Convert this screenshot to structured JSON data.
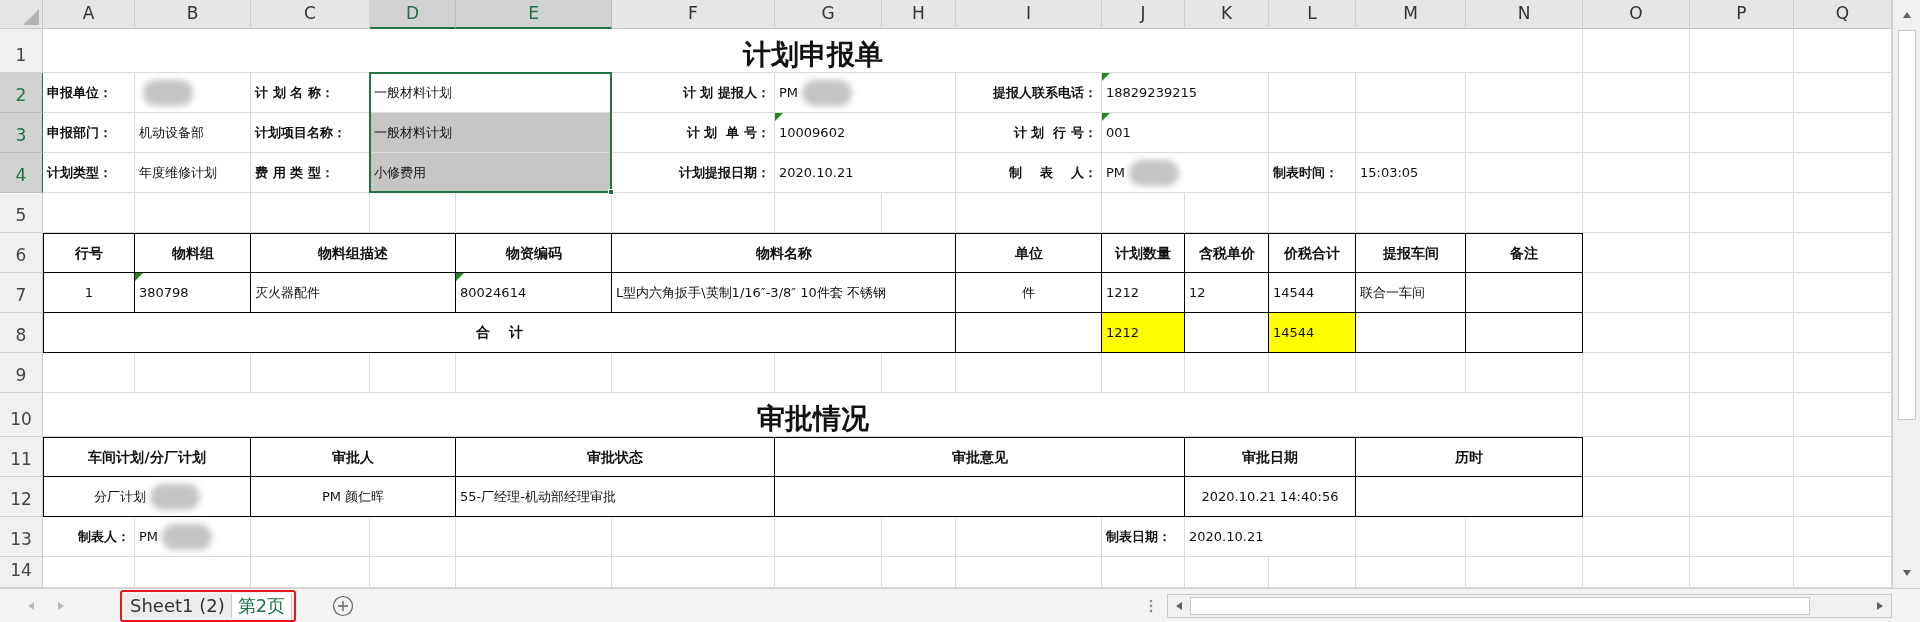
{
  "column_headers": [
    {
      "label": "A",
      "selected": false
    },
    {
      "label": "B",
      "selected": false
    },
    {
      "label": "C",
      "selected": false
    },
    {
      "label": "D",
      "selected": true
    },
    {
      "label": "E",
      "selected": true
    },
    {
      "label": "F",
      "selected": false
    },
    {
      "label": "G",
      "selected": false
    },
    {
      "label": "H",
      "selected": false
    },
    {
      "label": "I",
      "selected": false
    },
    {
      "label": "J",
      "selected": false
    },
    {
      "label": "K",
      "selected": false
    },
    {
      "label": "L",
      "selected": false
    },
    {
      "label": "M",
      "selected": false
    },
    {
      "label": "N",
      "selected": false
    },
    {
      "label": "O",
      "selected": false
    },
    {
      "label": "P",
      "selected": false
    },
    {
      "label": "Q",
      "selected": false
    }
  ],
  "row_headers": [
    {
      "label": "1",
      "selected": false
    },
    {
      "label": "2",
      "selected": true
    },
    {
      "label": "3",
      "selected": true
    },
    {
      "label": "4",
      "selected": true
    },
    {
      "label": "5",
      "selected": false
    },
    {
      "label": "6",
      "selected": false
    },
    {
      "label": "7",
      "selected": false
    },
    {
      "label": "8",
      "selected": false
    },
    {
      "label": "9",
      "selected": false
    },
    {
      "label": "10",
      "selected": false
    },
    {
      "label": "11",
      "selected": false
    },
    {
      "label": "12",
      "selected": false
    },
    {
      "label": "13",
      "selected": false
    },
    {
      "label": "14",
      "selected": false
    }
  ],
  "title": "计划申报单",
  "form": [
    [
      {
        "kind": "label",
        "text": "申报单位："
      },
      {
        "kind": "value",
        "flagged": false,
        "redacted": true
      },
      {
        "kind": "label",
        "text": "计 划 名 称："
      },
      {
        "kind": "value",
        "text": "一般材料计划",
        "flagged": false,
        "redacted": false,
        "selected": false
      },
      {
        "kind": "label",
        "text": "计 划 提报人："
      },
      {
        "kind": "value",
        "text": "PM",
        "flagged": false,
        "redacted": true
      },
      {
        "kind": "label",
        "text": "提报人联系电话："
      },
      {
        "kind": "value",
        "text": "18829239215",
        "flagged": true,
        "redacted": false
      }
    ],
    [
      {
        "kind": "label",
        "text": "申报部门："
      },
      {
        "kind": "value",
        "text": "机动设备部",
        "flagged": false,
        "redacted": false
      },
      {
        "kind": "label",
        "text": "计划项目名称："
      },
      {
        "kind": "value",
        "text": "一般材料计划",
        "flagged": false,
        "redacted": false,
        "selected": true
      },
      {
        "kind": "label",
        "text": "计 划  单 号："
      },
      {
        "kind": "value",
        "text": "10009602",
        "flagged": true,
        "redacted": false
      },
      {
        "kind": "label",
        "text": "计 划  行 号："
      },
      {
        "kind": "value",
        "text": "001",
        "flagged": true,
        "redacted": false
      }
    ],
    [
      {
        "kind": "label",
        "text": "计划类型："
      },
      {
        "kind": "value",
        "text": "年度维修计划",
        "flagged": false,
        "redacted": false
      },
      {
        "kind": "label",
        "text": "费 用 类 型："
      },
      {
        "kind": "value",
        "text": "小修费用",
        "flagged": false,
        "redacted": false,
        "selected": true
      },
      {
        "kind": "label",
        "text": "计划提报日期："
      },
      {
        "kind": "value",
        "text": "2020.10.21",
        "flagged": false,
        "redacted": false
      },
      {
        "kind": "label",
        "text": "制    表    人："
      },
      {
        "kind": "value",
        "text": "PM",
        "flagged": false,
        "redacted": true
      },
      {
        "kind": "label",
        "text": "制表时间："
      },
      {
        "kind": "value",
        "text": "15:03:05",
        "flagged": false,
        "redacted": false
      }
    ]
  ],
  "material_table": {
    "columns": [
      "行号",
      "物料组",
      "物料组描述",
      "物资编码",
      "物料名称",
      "单位",
      "计划数量",
      "含税单价",
      "价税合计",
      "提报车间",
      "备注"
    ],
    "rows": [
      [
        {
          "text": "1",
          "flagged": false
        },
        {
          "text": "380798",
          "flagged": true
        },
        {
          "text": "灭火器配件",
          "flagged": false
        },
        {
          "text": "80024614",
          "flagged": true
        },
        {
          "text": "L型内六角扳手\\英制1/16″-3/8″ 10件套 不锈钢",
          "flagged": false
        },
        {
          "text": "件",
          "flagged": false
        },
        {
          "text": "1212",
          "flagged": false
        },
        {
          "text": "12",
          "flagged": false
        },
        {
          "text": "14544",
          "flagged": false
        },
        {
          "text": "联合一车间",
          "flagged": false
        }
      ]
    ],
    "total": {
      "label": "合    计",
      "quantity": {
        "text": "1212",
        "highlighted": true
      },
      "amount": {
        "text": "14544",
        "highlighted": true
      }
    }
  },
  "approval_title": "审批情况",
  "approval_table": {
    "columns": [
      "车间计划/分厂计划",
      "审批人",
      "审批状态",
      "审批意见",
      "审批日期",
      "历时"
    ],
    "rows": [
      {
        "plan": {
          "text": "分厂计划",
          "redacted": true
        },
        "approver": {
          "text": "PM 颜仁晖",
          "redacted": false
        },
        "status": {
          "text": "55-厂经理-机动部经理审批",
          "redacted": false
        },
        "date": {
          "text": "2020.10.21 14:40:56",
          "redacted": false
        }
      }
    ]
  },
  "footer": [
    {
      "label": "制表人：",
      "value": {
        "text": "PM",
        "redacted": true
      }
    },
    {
      "label": "制表日期：",
      "value": {
        "text": "2020.10.21",
        "redacted": false
      }
    }
  ],
  "sheet_tabs": [
    {
      "label": "Sheet1 (2)",
      "selected": false
    },
    {
      "label": "第2页",
      "selected": true
    }
  ]
}
